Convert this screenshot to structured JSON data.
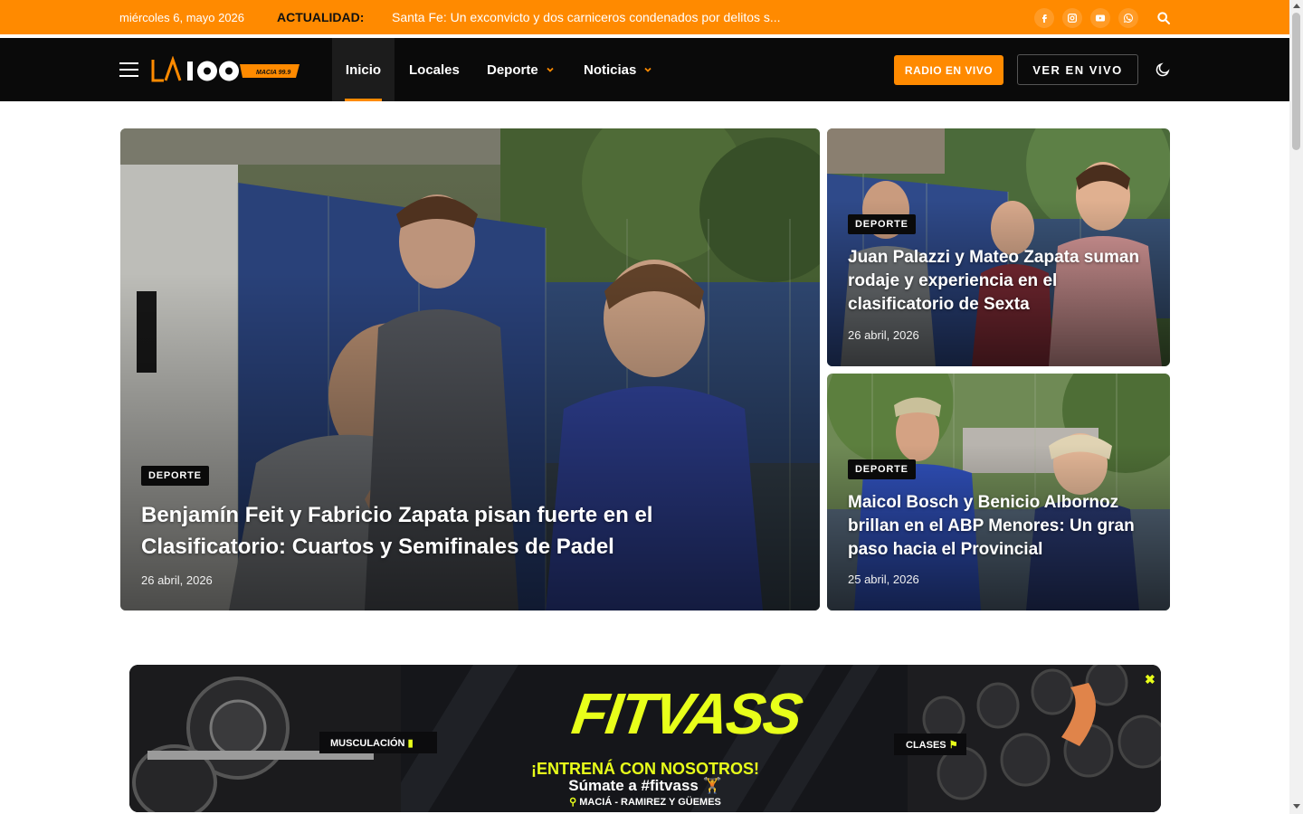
{
  "topbar": {
    "date": "miércoles 6, mayo 2026",
    "ticker_label": "ACTUALIDAD:",
    "ticker_text": "Santa Fe: Un exconvicto y dos carniceros condenados por delitos s...",
    "social": [
      "facebook-icon",
      "instagram-icon",
      "youtube-icon",
      "whatsapp-icon"
    ],
    "accent": "#ff8a00"
  },
  "nav": {
    "logo_text": "LA 100",
    "logo_sub": "MACIA 99.9",
    "items": [
      {
        "label": "Inicio",
        "active": true
      },
      {
        "label": "Locales"
      },
      {
        "label": "Deporte",
        "dropdown": true
      },
      {
        "label": "Noticias",
        "dropdown": true
      }
    ],
    "radio_button": "RADIO EN VIVO",
    "ver_button": "VER EN VIVO"
  },
  "featured": {
    "main": {
      "category": "DEPORTE",
      "title_line1": "Benjamín Feit y Fabricio Zapata pisan fuerte en el",
      "title_line2": "Clasificatorio: Cuartos y Semifinales de Padel",
      "date": "26 abril, 2026"
    },
    "side": [
      {
        "category": "DEPORTE",
        "title_line1": "Juan Palazzi y Mateo Zapata suman",
        "title_line2": "rodaje y experiencia en el",
        "title_line3": "clasificatorio de Sexta",
        "date": "26 abril, 2026"
      },
      {
        "category": "DEPORTE",
        "title_line1": "Maicol Bosch y Benicio Albornoz",
        "title_line2": "brillan en el ABP Menores: Un gran",
        "title_line3": "paso hacia el Provincial",
        "date": "25 abril, 2026"
      }
    ]
  },
  "ad": {
    "brand": "FITVASS",
    "headline": "¡ENTRENÁ CON NOSOTROS!",
    "sub": "Súmate a #fitvass 🏋️",
    "location": "MACIÁ - RAMIREZ Y GÜEMES",
    "tag_left": "MUSCULACIÓN",
    "tag_right": "CLASES",
    "close": "✖"
  }
}
